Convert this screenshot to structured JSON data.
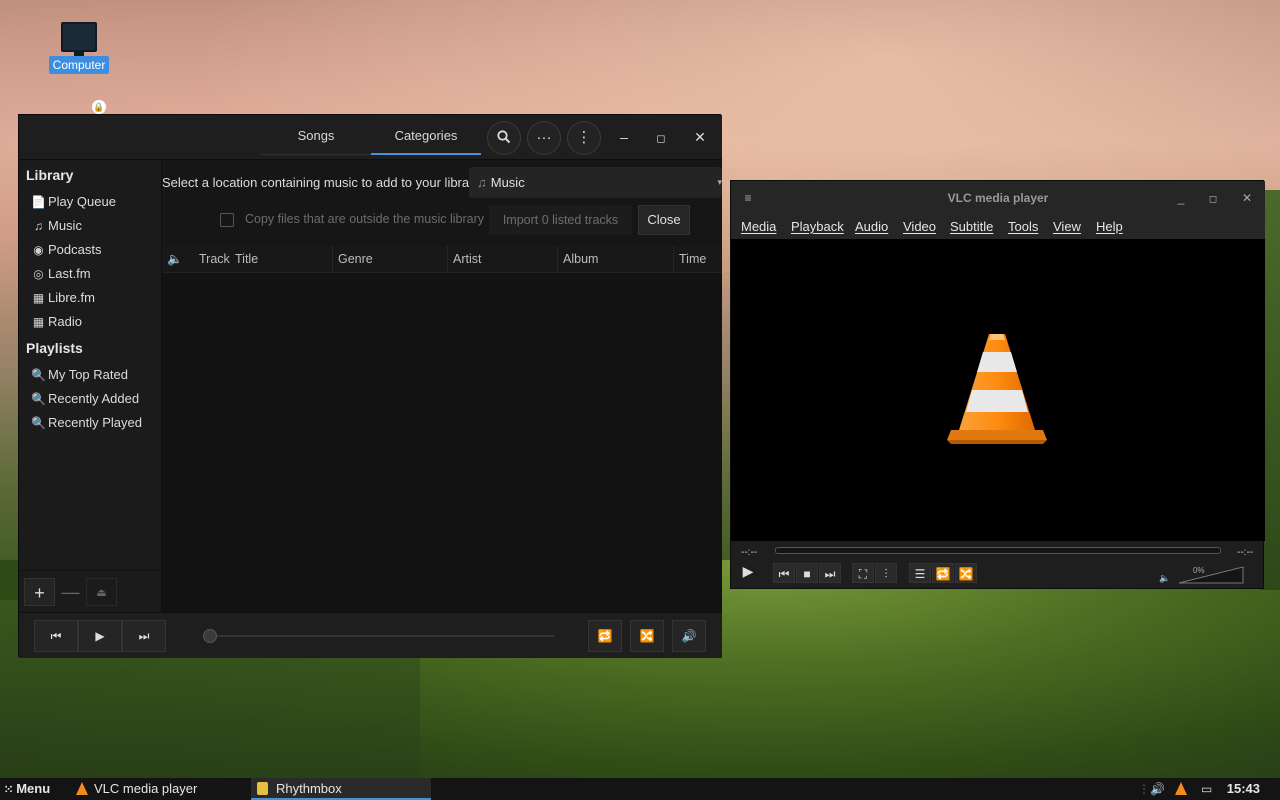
{
  "desktop": {
    "icon_label": "Computer"
  },
  "rhythmbox": {
    "tabs": {
      "songs": "Songs",
      "categories": "Categories"
    },
    "header_icons": {
      "search": "search-icon",
      "more_h": "ellipsis-horizontal-icon",
      "more_v": "ellipsis-vertical-icon"
    },
    "sidebar": {
      "library_heading": "Library",
      "library_items": [
        {
          "label": "Play Queue",
          "icon": "📄"
        },
        {
          "label": "Music",
          "icon": "♫"
        },
        {
          "label": "Podcasts",
          "icon": "◉"
        },
        {
          "label": "Last.fm",
          "icon": "◎"
        },
        {
          "label": "Libre.fm",
          "icon": "▦"
        },
        {
          "label": "Radio",
          "icon": "▦"
        }
      ],
      "playlists_heading": "Playlists",
      "playlist_items": [
        {
          "label": "My Top Rated",
          "icon": "🔍"
        },
        {
          "label": "Recently Added",
          "icon": "🔍"
        },
        {
          "label": "Recently Played",
          "icon": "🔍"
        }
      ],
      "tools": {
        "add": "+",
        "remove": "—",
        "eject": "⏏"
      }
    },
    "import": {
      "location_label": "Select a location containing music to add to your library:",
      "location_value": "Music",
      "copy_files_label": "Copy files that are outside the music library",
      "import_button": "Import 0 listed tracks",
      "close_button": "Close"
    },
    "columns": [
      "Track",
      "Title",
      "Genre",
      "Artist",
      "Album",
      "Time"
    ],
    "footer": {
      "prev": "⏮",
      "play": "▶",
      "next": "⏭",
      "repeat": "🔁",
      "shuffle": "🔀",
      "volume": "🔊"
    }
  },
  "vlc": {
    "title": "VLC media player",
    "menu": [
      "Media",
      "Playback",
      "Audio",
      "Video",
      "Subtitle",
      "Tools",
      "View",
      "Help"
    ],
    "time_elapsed": "--:--",
    "time_remaining": "--:--",
    "volume_percent": "0%"
  },
  "taskbar": {
    "menu_label": "Menu",
    "apps": [
      {
        "label": "VLC media player"
      },
      {
        "label": "Rhythmbox"
      }
    ],
    "clock": "15:43"
  }
}
